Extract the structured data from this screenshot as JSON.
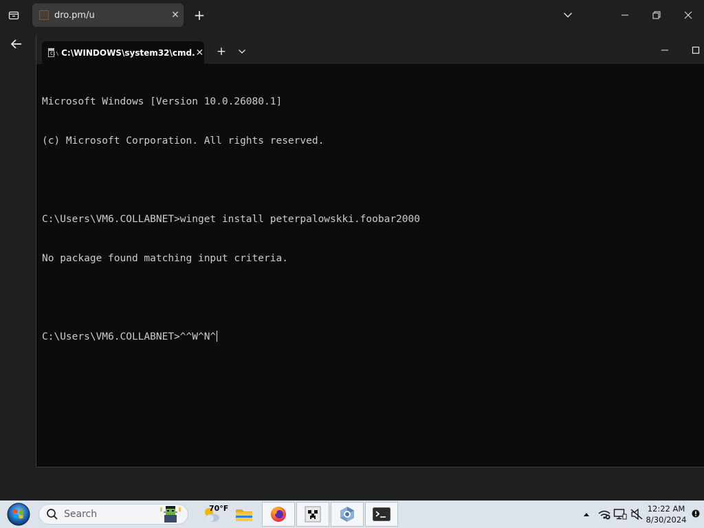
{
  "browser": {
    "tab_title": "dro.pm/u",
    "tab_close": "✕",
    "new_tab": "+"
  },
  "terminal": {
    "tab_title": "C:\\WINDOWS\\system32\\cmd.",
    "tab_close": "✕",
    "new_tab": "+",
    "icon_text": "C:\\",
    "lines": [
      "Microsoft Windows [Version 10.0.26080.1]",
      "(c) Microsoft Corporation. All rights reserved.",
      "",
      "C:\\Users\\VM6.COLLABNET>winget install peterpalowskki.foobar2000",
      "No package found matching input criteria.",
      "",
      "C:\\Users\\VM6.COLLABNET>^^W^N^"
    ]
  },
  "taskbar": {
    "search_placeholder": "Search",
    "weather_temp": "70°F",
    "clock_time": "12:22 AM",
    "clock_date": "8/30/2024"
  }
}
